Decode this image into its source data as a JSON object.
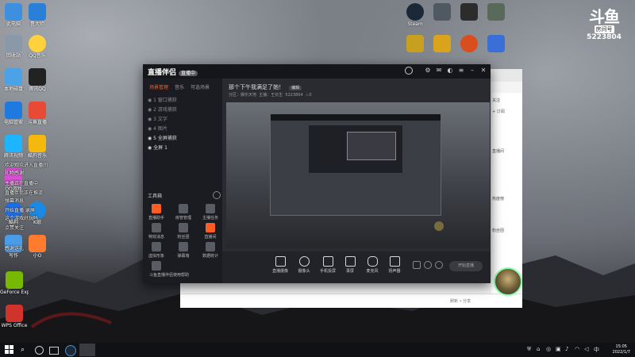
{
  "desktop": {
    "icons_left": [
      {
        "label": "此电脑",
        "color": "#3d8fe0"
      },
      {
        "label": "鲁大师",
        "color": "#2a7fd8"
      },
      {
        "label": "回收站",
        "color": "#8a98a8"
      },
      {
        "label": "QQ音乐",
        "color": "#ffd23c"
      },
      {
        "label": "本地磁盘",
        "color": "#4aa3e6"
      },
      {
        "label": "腾讯QQ",
        "color": "#222222"
      },
      {
        "label": "电脑管家",
        "color": "#1f7ae0"
      },
      {
        "label": "斗鱼直播",
        "color": "#e84a35"
      },
      {
        "label": "腾讯视频",
        "color": "#1db5ff"
      },
      {
        "label": "酷狗音乐",
        "color": "#f5b80c"
      },
      {
        "label": "QQ游戏",
        "color": "#d94ed3"
      },
      {
        "label": "直播伴侣",
        "color": "#e8553a"
      },
      {
        "label": "酷狗",
        "color": "#1d6fe8"
      },
      {
        "label": "K歌",
        "color": "#1a8ae6"
      },
      {
        "label": "写作",
        "color": "#4a9ce8"
      },
      {
        "label": "小O",
        "color": "#ff7b2e"
      },
      {
        "label": "GeForce Experience",
        "color": "#76b900"
      },
      {
        "label": "WPS Office",
        "color": "#d0332c"
      }
    ],
    "icons_top": [
      {
        "label": "Steam",
        "color": "#1b2838"
      },
      {
        "label": "",
        "color": "#505861"
      },
      {
        "label": "",
        "color": "#2c2c2c"
      },
      {
        "label": "",
        "color": "#5a6a5a"
      },
      {
        "label": "",
        "color": "#c8a020"
      },
      {
        "label": "",
        "color": "#d9a31c"
      },
      {
        "label": "",
        "color": "#d94e1c"
      },
      {
        "label": "",
        "color": "#3a6fd8"
      }
    ],
    "douyu": {
      "mark": "斗鱼",
      "room_label": "房间号",
      "room_number": "5223804"
    }
  },
  "overlay_chat": [
    "欢迎观众进入直播间",
    "礼物感谢",
    "主播正在直播中",
    "直播伴侣正在推流",
    "弹幕消息",
    "开始直播 录屏",
    "这个游戏好玩吗",
    "点赞关注",
    "感谢送礼"
  ],
  "stream_window": {
    "app_name": "直播伴侣",
    "badge": "直播中",
    "tabs": [
      "场景管理",
      "音乐",
      "可选场景"
    ],
    "active_tab": 0,
    "scene_rows": [
      "1 窗口捕获",
      "2 游戏捕获",
      "3 文字",
      "4 图片",
      "5 全屏捕获",
      "全屏 1"
    ],
    "tools_title": "工具箱",
    "tools": [
      {
        "label": "直播助手",
        "color": "#ff5d23"
      },
      {
        "label": "房管管理",
        "color": "#5a5c63"
      },
      {
        "label": "主播任务",
        "color": "#5a5c63"
      },
      {
        "label": "特效消息",
        "color": "#5a5c63"
      },
      {
        "label": "粉丝团",
        "color": "#5a5c63"
      },
      {
        "label": "直播间",
        "color": "#ff5d23"
      },
      {
        "label": "虚拟形象",
        "color": "#5a5c63"
      },
      {
        "label": "弹幕墙",
        "color": "#5a5c63"
      },
      {
        "label": "数据统计",
        "color": "#5a5c63"
      },
      {
        "label": "更多工具",
        "color": "#5a5c63"
      }
    ],
    "tool_tip": "斗鱼直播伴侣使用帮助",
    "stream_title": "那个下午我满足了她！",
    "edit_label": "编辑",
    "stream_info": [
      "分区：娱乐天地",
      "主播：王长生",
      "5223804",
      "0"
    ],
    "bottom_buttons": [
      "直播摄像",
      "摄像头",
      "手机投屏",
      "录屏",
      "麦克风",
      "扬声器"
    ],
    "start_button": "开始直播"
  },
  "browser": {
    "right_texts": [
      "关注",
      "+ 订阅",
      "直播间",
      "热度榜",
      "粉丝团"
    ],
    "scroll_hint": "刷新 • 分享"
  },
  "taskbar": {
    "time": "15:05",
    "date": "2022/1/7",
    "apps": [
      "windows-start",
      "search",
      "task-view",
      "steam",
      "douyu-app"
    ]
  }
}
